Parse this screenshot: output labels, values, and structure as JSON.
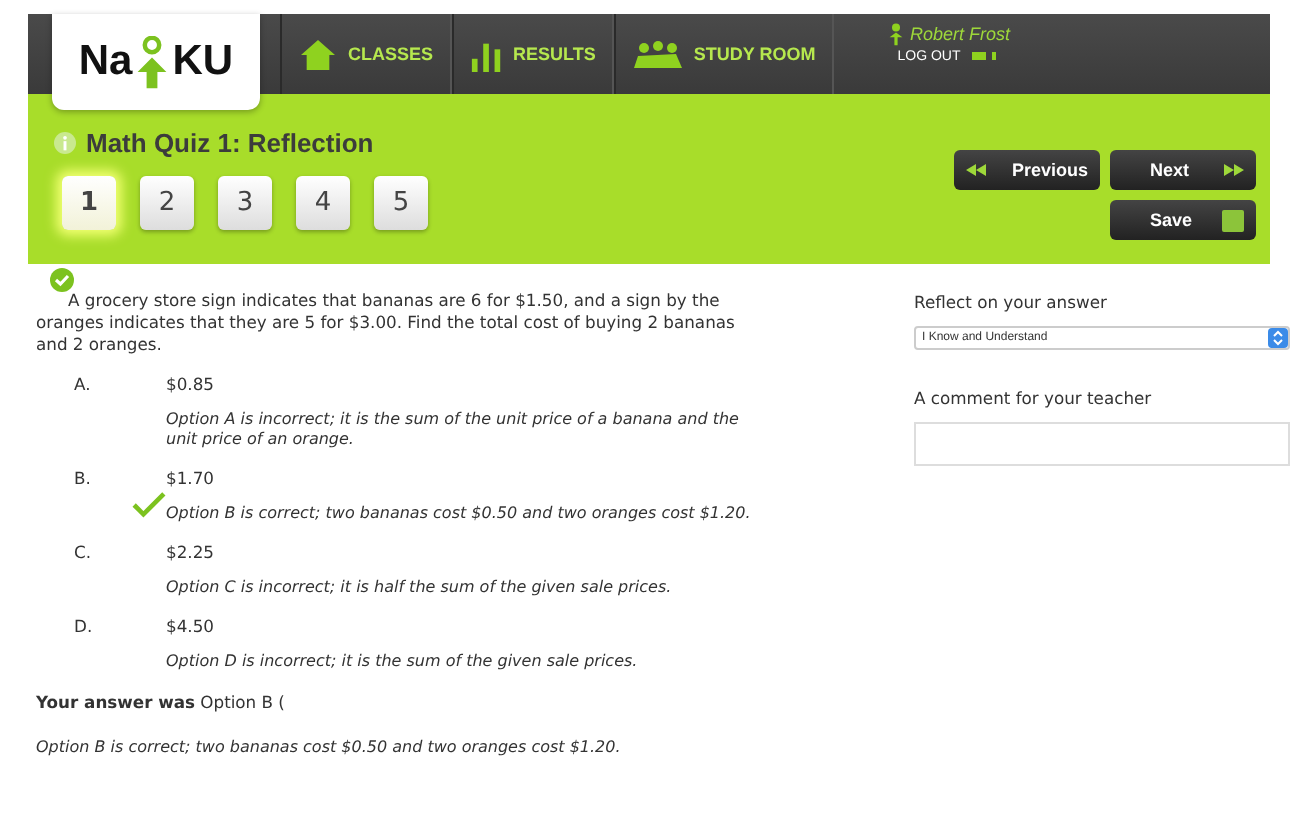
{
  "logo": {
    "left": "Na",
    "right": "KU"
  },
  "nav": [
    {
      "label": "CLASSES",
      "kind": "house"
    },
    {
      "label": "RESULTS",
      "kind": "bars"
    },
    {
      "label": "STUDY ROOM",
      "kind": "people"
    }
  ],
  "user": {
    "name": "Robert Frost",
    "logout": "LOG OUT"
  },
  "quiz": {
    "title": "Math Quiz 1: Reflection",
    "questions": [
      {
        "label": "1",
        "selected": true
      },
      {
        "label": "2",
        "selected": false
      },
      {
        "label": "3",
        "selected": false
      },
      {
        "label": "4",
        "selected": false
      },
      {
        "label": "5",
        "selected": false
      }
    ]
  },
  "buttons": {
    "previous": "Previous",
    "next": "Next",
    "save": "Save"
  },
  "question": {
    "text": "A grocery store sign indicates that bananas are 6 for $1.50, and a sign by the oranges indicates that they are 5 for $3.00. Find the total cost of buying 2 bananas and 2 oranges.",
    "options": [
      {
        "letter": "A.",
        "value": "$0.85",
        "feedback": "Option A is incorrect; it is the sum of the unit price of a banana and the unit price of an orange.",
        "correct": false
      },
      {
        "letter": "B.",
        "value": "$1.70",
        "feedback": "Option B is correct; two bananas cost $0.50 and two oranges cost $1.20.",
        "correct": true
      },
      {
        "letter": "C.",
        "value": "$2.25",
        "feedback": "Option C is incorrect; it is half the sum of the given sale prices.",
        "correct": false
      },
      {
        "letter": "D.",
        "value": "$4.50",
        "feedback": "Option D is incorrect; it is the sum of the given sale prices.",
        "correct": false
      }
    ],
    "answer": "**Your answer was** Option B (",
    "answer_feedback": "Option B is correct; two bananas cost $0.50 and two oranges cost $1.20."
  },
  "reflect": {
    "label": "Reflect on your answer",
    "value": "I Know and Understand",
    "comment_label": "A comment for your teacher"
  }
}
